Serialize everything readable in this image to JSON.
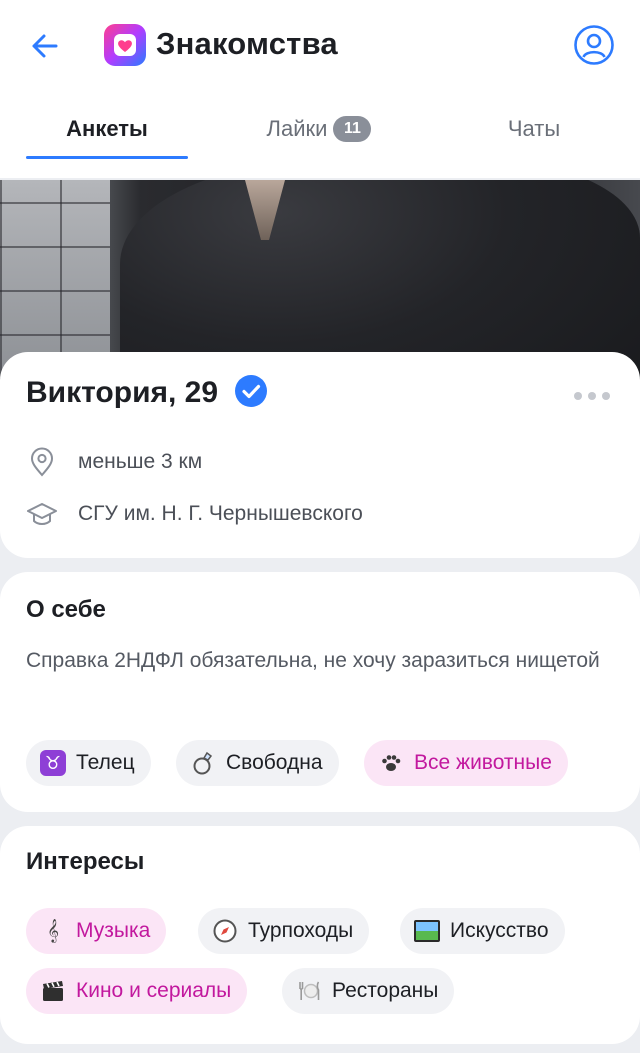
{
  "header": {
    "title": "Знакомства",
    "colors": {
      "accent": "#2d7bff",
      "logo_gradient": [
        "#ff3e8e",
        "#b23cff",
        "#2a7bff"
      ]
    }
  },
  "tabs": [
    {
      "label": "Анкеты",
      "active": true
    },
    {
      "label": "Лайки",
      "badge": "11",
      "active": false
    },
    {
      "label": "Чаты",
      "active": false
    }
  ],
  "profile": {
    "name_age": "Виктория, 29",
    "verified": true,
    "distance": "меньше 3 км",
    "university": "СГУ им. Н. Г. Чернышевского"
  },
  "about": {
    "title": "О себе",
    "text": "Справка 2НДФЛ обязательна, не хочу заразиться нищетой",
    "chips": [
      {
        "label": "Телец",
        "icon": "taurus-icon",
        "highlight": false
      },
      {
        "label": "Свободна",
        "icon": "ring-icon",
        "highlight": false
      },
      {
        "label": "Все животные",
        "icon": "paw-icon",
        "highlight": true
      }
    ]
  },
  "interests": {
    "title": "Интересы",
    "chips": [
      {
        "label": "Музыка",
        "icon": "music-icon",
        "highlight": true
      },
      {
        "label": "Турпоходы",
        "icon": "compass-icon",
        "highlight": false
      },
      {
        "label": "Искусство",
        "icon": "picture-icon",
        "highlight": false
      },
      {
        "label": "Кино и сериалы",
        "icon": "clapper-icon",
        "highlight": true
      },
      {
        "label": "Рестораны",
        "icon": "plate-icon",
        "highlight": false
      }
    ]
  }
}
